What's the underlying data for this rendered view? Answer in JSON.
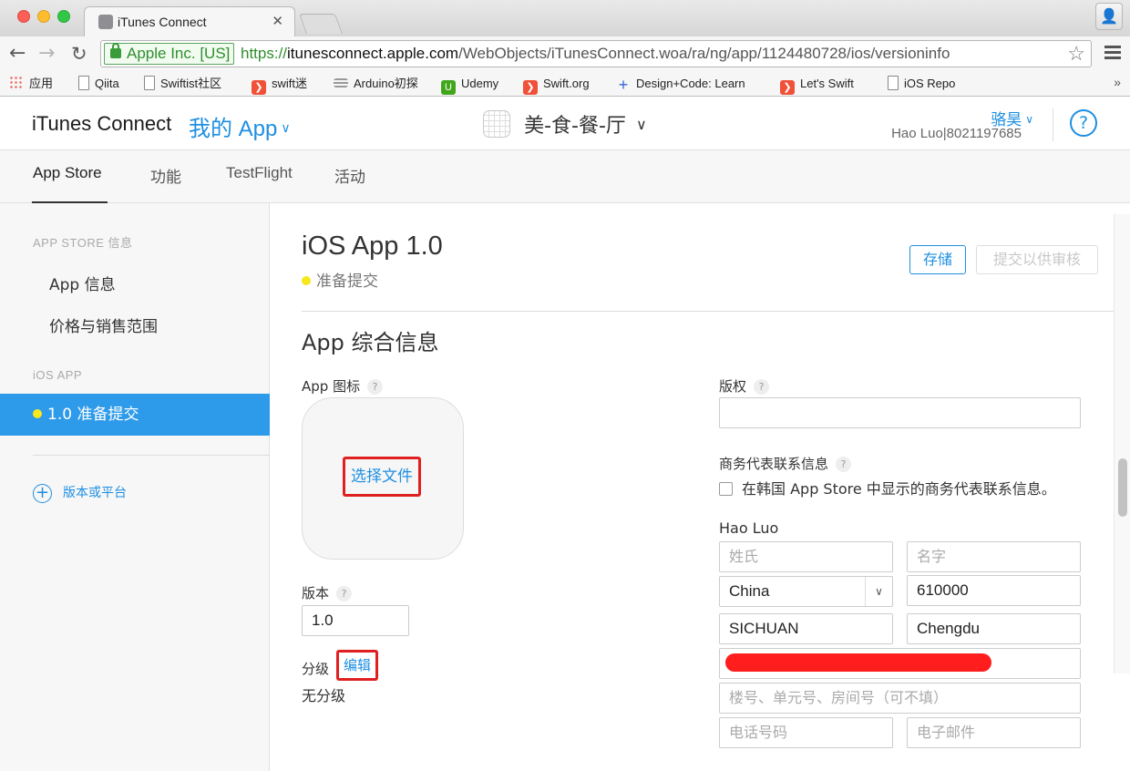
{
  "browser": {
    "tab_title": "iTunes Connect",
    "tab_close": "✕",
    "ev_label": "Apple Inc. [US]",
    "url_scheme": "https://",
    "url_host": "itunesconnect.apple.com",
    "url_path": "/WebObjects/iTunesConnect.woa/ra/ng/app/1124480728/ios/versioninfo",
    "bookmarks": [
      "应用",
      "Qiita",
      "Swiftist社区",
      "swift迷",
      "Arduino初探",
      "Udemy",
      "Swift.org",
      "Design+Code: Learn",
      "Let's Swift",
      "iOS Repo"
    ],
    "bookmarks_more": "»"
  },
  "header": {
    "brand": "iTunes Connect",
    "my_app": "我的 App",
    "app_name": "美-食-餐-厅",
    "user_name": "骆昊",
    "user_id": "Hao Luo|8021197685",
    "help": "?"
  },
  "nav": {
    "tabs": [
      "App Store",
      "功能",
      "TestFlight",
      "活动"
    ]
  },
  "sidebar": {
    "section1": "APP STORE 信息",
    "items": [
      "App 信息",
      "价格与销售范围"
    ],
    "section2": "iOS APP",
    "active_item": "1.0 准备提交",
    "add_label": "版本或平台"
  },
  "version": {
    "title": "iOS App 1.0",
    "status": "准备提交",
    "save_label": "存储",
    "submit_label": "提交以供审核"
  },
  "general": {
    "section_title": "App 综合信息",
    "icon_label": "App 图标",
    "choose_file": "选择文件",
    "version_label": "版本",
    "version_value": "1.0",
    "rating_label": "分级",
    "rating_edit": "编辑",
    "rating_value": "无分级",
    "copyright_label": "版权",
    "copyright_value": "",
    "contact_label": "商务代表联系信息",
    "korea_checkbox": "在韩国 App Store 中显示的商务代表联系信息。",
    "contact_name": "Hao Luo",
    "last_name_ph": "姓氏",
    "first_name_ph": "名字",
    "country": "China",
    "postal_code": "610000",
    "state": "SICHUAN",
    "city": "Chengdu",
    "address2_ph": "楼号、单元号、房间号（可不填）",
    "phone_ph": "电话号码",
    "email_ph": "电子邮件"
  },
  "colors": {
    "accent": "#1e8fe1",
    "active_sidebar": "#2e9bea",
    "status_dot": "#f8e71c",
    "highlight_box": "#e02020",
    "redaction": "#ff1d1d"
  }
}
